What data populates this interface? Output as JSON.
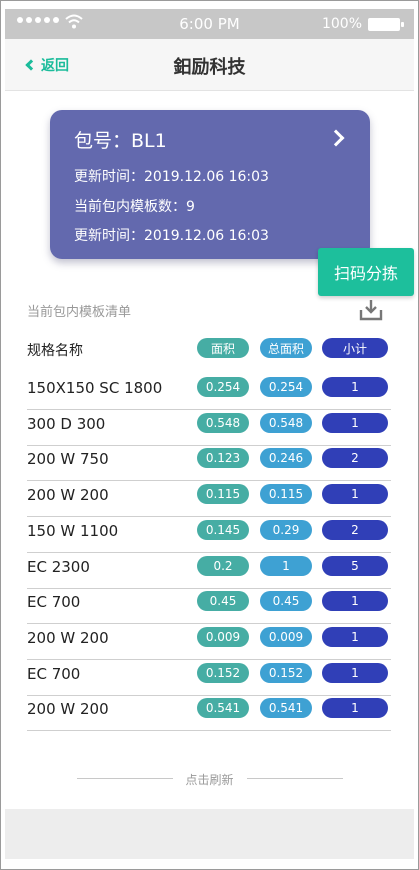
{
  "status_bar": {
    "time": "6:00 PM",
    "battery": "100%"
  },
  "nav": {
    "back_label": "返回",
    "title": "鈤励科技"
  },
  "package": {
    "number_line": "包号：BL1",
    "update_time_1": "更新时间：2019.12.06 16:03",
    "template_count": "当前包内模板数：9",
    "update_time_2": "更新时间：2019.12.06 16:03"
  },
  "scan_button": "扫码分拣",
  "list": {
    "title": "当前包内模板清单",
    "headers": {
      "spec": "规格名称",
      "area": "面积",
      "total_area": "总面积",
      "subtotal": "小计"
    },
    "rows": [
      {
        "spec": "150X150 SC 1800",
        "area": "0.254",
        "total": "0.254",
        "qty": "1"
      },
      {
        "spec": "300 D 300",
        "area": "0.548",
        "total": "0.548",
        "qty": "1"
      },
      {
        "spec": "200 W 750",
        "area": "0.123",
        "total": "0.246",
        "qty": "2"
      },
      {
        "spec": "200 W 200",
        "area": "0.115",
        "total": "0.115",
        "qty": "1"
      },
      {
        "spec": "150 W 1100",
        "area": "0.145",
        "total": "0.29",
        "qty": "2"
      },
      {
        "spec": "EC 2300",
        "area": "0.2",
        "total": "1",
        "qty": "5"
      },
      {
        "spec": "EC 700",
        "area": "0.45",
        "total": "0.45",
        "qty": "1"
      },
      {
        "spec": "200 W 200",
        "area": "0.009",
        "total": "0.009",
        "qty": "1"
      },
      {
        "spec": "EC 700",
        "area": "0.152",
        "total": "0.152",
        "qty": "1"
      },
      {
        "spec": "200 W 200",
        "area": "0.541",
        "total": "0.541",
        "qty": "1"
      }
    ]
  },
  "refresh_label": "点击刷新",
  "colors": {
    "accent": "#1bbc9b",
    "card": "#6369ae",
    "area_pill": "#46ada4",
    "total_pill": "#3ea1d3",
    "qty_pill": "#303fb7"
  }
}
